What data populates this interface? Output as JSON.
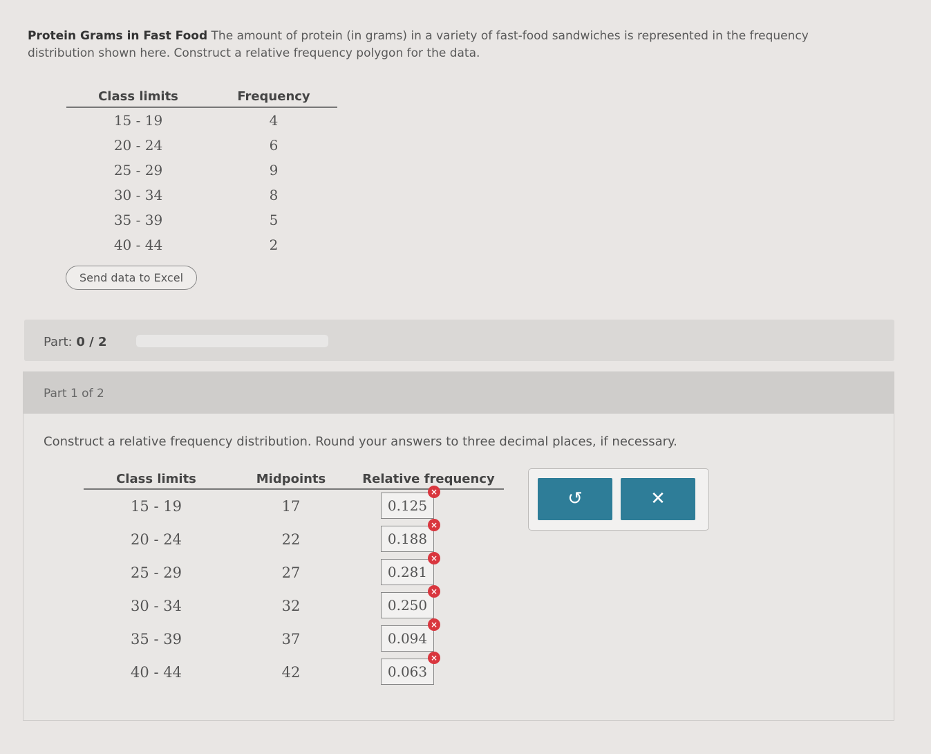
{
  "problem": {
    "title": "Protein Grams in Fast Food",
    "text": "The amount of protein (in grams) in a variety of fast-food sandwiches is represented in the frequency distribution shown here. Construct a relative frequency polygon for the data."
  },
  "source_table": {
    "headers": [
      "Class limits",
      "Frequency"
    ],
    "rows": [
      {
        "limits": "15 - 19",
        "freq": "4"
      },
      {
        "limits": "20 - 24",
        "freq": "6"
      },
      {
        "limits": "25 - 29",
        "freq": "9"
      },
      {
        "limits": "30 - 34",
        "freq": "8"
      },
      {
        "limits": "35 - 39",
        "freq": "5"
      },
      {
        "limits": "40 - 44",
        "freq": "2"
      }
    ]
  },
  "excel_button": "Send data to Excel",
  "part_progress": {
    "label": "Part:",
    "value": "0 / 2",
    "fraction": 0
  },
  "part1": {
    "header": "Part 1 of 2",
    "instruction": "Construct a relative frequency distribution. Round your answers to three decimal places, if necessary.",
    "headers": [
      "Class limits",
      "Midpoints",
      "Relative frequency"
    ],
    "rows": [
      {
        "limits": "15 - 19",
        "mid": "17",
        "rel": "0.125"
      },
      {
        "limits": "20 - 24",
        "mid": "22",
        "rel": "0.188"
      },
      {
        "limits": "25 - 29",
        "mid": "27",
        "rel": "0.281"
      },
      {
        "limits": "30 - 34",
        "mid": "32",
        "rel": "0.250"
      },
      {
        "limits": "35 - 39",
        "mid": "37",
        "rel": "0.094"
      },
      {
        "limits": "40 - 44",
        "mid": "42",
        "rel": "0.063"
      }
    ],
    "error_icon": "×"
  },
  "actions": {
    "undo_icon": "↺",
    "clear_icon": "✕"
  },
  "colors": {
    "accent": "#2e7d98",
    "error": "#d9363e"
  }
}
